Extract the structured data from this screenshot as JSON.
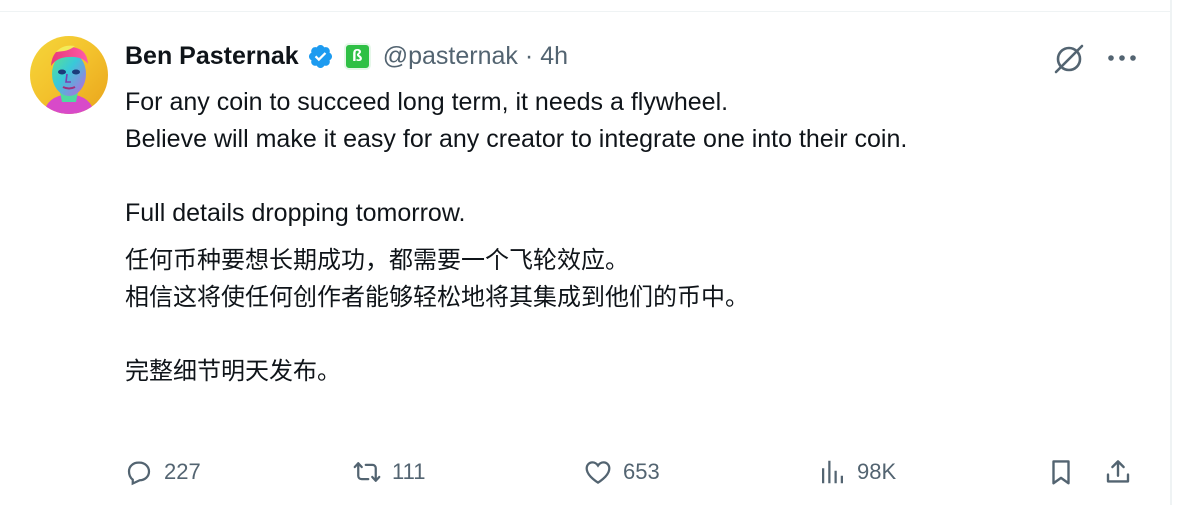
{
  "author": {
    "display_name": "Ben Pasternak",
    "handle": "@pasternak",
    "separator": "·",
    "time": "4h",
    "affiliate_badge_letter": "ß",
    "verified_color": "#1d9bf0",
    "affiliate_color": "#2fc045"
  },
  "post": {
    "en_line1": "For any coin to succeed long term, it needs a flywheel.",
    "en_line2": "Believe will make it easy for any creator to integrate one into their coin.",
    "en_line3": "Full details dropping tomorrow.",
    "cn_line1": "任何币种要想长期成功，都需要一个飞轮效应。",
    "cn_line2": "相信这将使任何创作者能够轻松地将其集成到他们的币中。",
    "cn_line3": "完整细节明天发布。"
  },
  "actions": {
    "replies": "227",
    "reposts": "111",
    "likes": "653",
    "views": "98K"
  },
  "icons": {
    "verified": "verified-badge-icon",
    "grok": "grok-icon",
    "more": "more-icon",
    "reply": "reply-icon",
    "repost": "repost-icon",
    "like": "heart-icon",
    "views": "views-icon",
    "bookmark": "bookmark-icon",
    "share": "share-icon"
  },
  "colors": {
    "text": "#0f1419",
    "secondary": "#536471",
    "divider": "#eff3f4"
  }
}
